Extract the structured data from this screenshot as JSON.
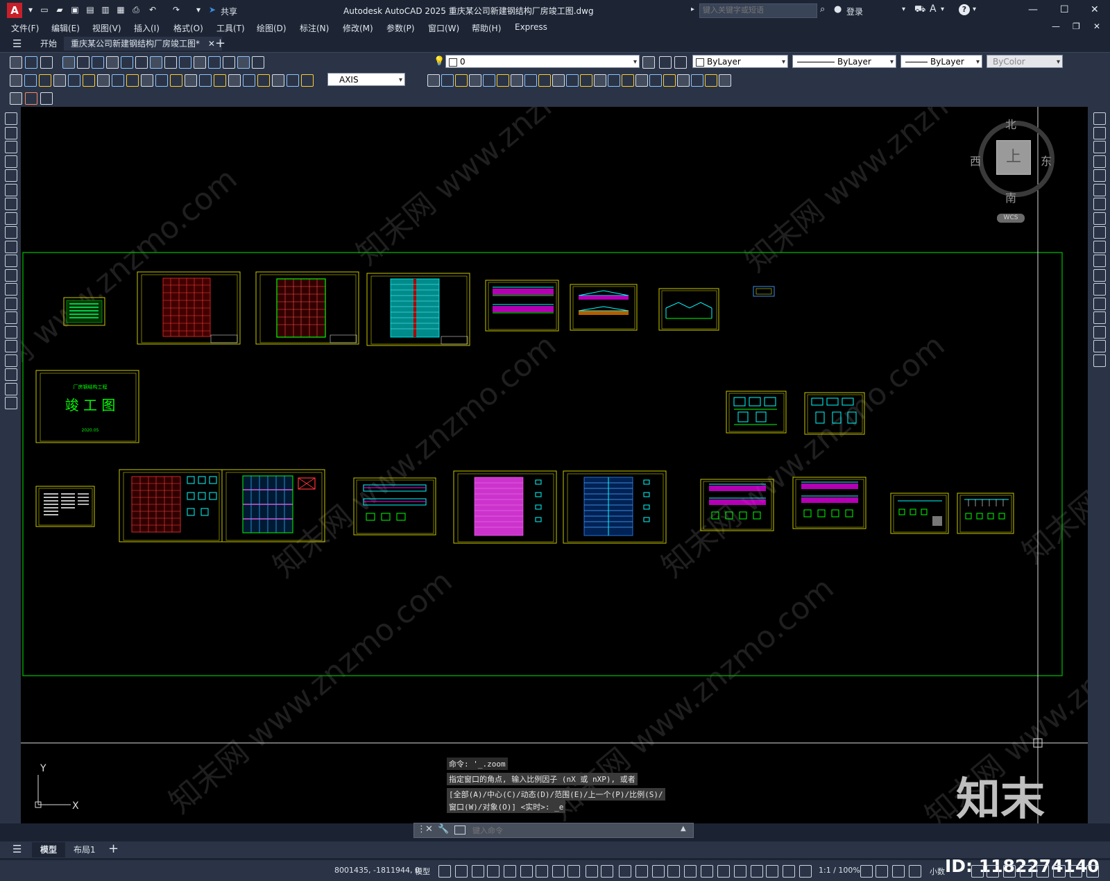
{
  "titlebar": {
    "share_label": "共享",
    "title": "Autodesk AutoCAD 2025    重庆某公司新建钢结构厂房竣工图.dwg",
    "search_placeholder": "键入关键字或短语",
    "login_label": "登录"
  },
  "menus": [
    "文件(F)",
    "编辑(E)",
    "视图(V)",
    "插入(I)",
    "格式(O)",
    "工具(T)",
    "绘图(D)",
    "标注(N)",
    "修改(M)",
    "参数(P)",
    "窗口(W)",
    "帮助(H)",
    "Express"
  ],
  "tabs": {
    "start": "开始",
    "active": "重庆某公司新建钢结构厂房竣工图*"
  },
  "toolbar": {
    "layer_value": "0",
    "color_value": "ByLayer",
    "linetype_value": "ByLayer",
    "lineweight_value": "ByLayer",
    "plotstyle_value": "ByColor",
    "dimstyle_value": "AXIS"
  },
  "viewcube": {
    "north": "北",
    "south": "南",
    "east": "东",
    "west": "西",
    "face": "上",
    "wcs": "WCS"
  },
  "sheets": {
    "cover_subtitle": "厂房钢结构工程",
    "cover_title": "竣 工 图",
    "cover_date": "2020.05"
  },
  "ucs": {
    "x_label": "X",
    "y_label": "Y"
  },
  "command": {
    "history": [
      "命令: '_.zoom",
      "指定窗口的角点, 输入比例因子 (nX 或 nXP), 或者",
      "[全部(A)/中心(C)/动态(D)/范围(E)/上一个(P)/比例(S)/",
      "窗口(W)/对象(O)] <实时>: _e"
    ],
    "input_placeholder": "键入命令"
  },
  "layouts": {
    "model": "模型",
    "layout1": "布局1"
  },
  "status": {
    "coords": "8001435, -1811944, 0",
    "mode": "模型",
    "scale": "1:1 / 100%",
    "units": "小数"
  },
  "watermark": {
    "brand": "知末",
    "id": "ID: 1182274140"
  },
  "colors": {
    "canvas": "#000000",
    "frame": "#00c000",
    "sheet_border": "#c8c800",
    "accent": "#3a8ee6"
  }
}
